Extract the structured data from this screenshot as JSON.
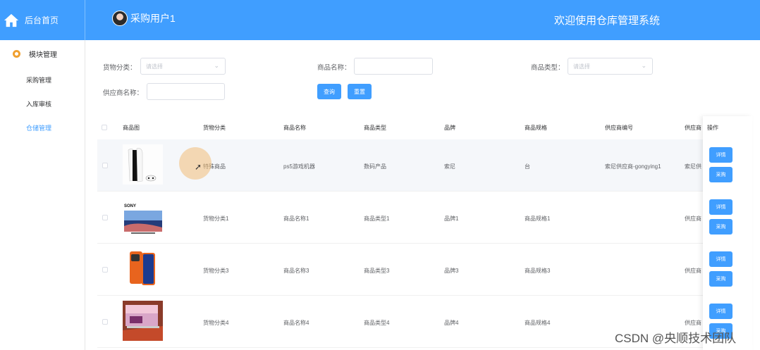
{
  "header": {
    "home_label": "后台首页",
    "user_name": "采购用户1",
    "welcome": "欢迎使用仓库管理系统"
  },
  "sidebar": {
    "group_label": "模块管理",
    "items": [
      {
        "label": "采购管理",
        "active": false
      },
      {
        "label": "入库审核",
        "active": false
      },
      {
        "label": "仓储管理",
        "active": true
      }
    ]
  },
  "search": {
    "category_label": "货物分类：",
    "category_placeholder": "请选择",
    "name_label": "商品名称：",
    "name_value": "",
    "type_label": "商品类型：",
    "type_placeholder": "请选择",
    "supplier_label": "供应商名称：",
    "supplier_value": "",
    "query_label": "查询",
    "reset_label": "重置"
  },
  "table": {
    "columns": [
      "商品图",
      "货物分类",
      "商品名称",
      "商品类型",
      "品牌",
      "商品规格",
      "供应商编号",
      "供应商",
      "操作"
    ],
    "rows": [
      {
        "category": "特殊商品",
        "name": "ps5游戏机器",
        "type": "数码产品",
        "brand": "索尼",
        "spec": "台",
        "supplier_no": "索尼供应商-gongying1",
        "supplier": "索尼供",
        "image": "ps5-console"
      },
      {
        "category": "货物分类1",
        "name": "商品名称1",
        "type": "商品类型1",
        "brand": "品牌1",
        "spec": "商品规格1",
        "supplier_no": "",
        "supplier": "供应商",
        "image": "sony-tv"
      },
      {
        "category": "货物分类3",
        "name": "商品名称3",
        "type": "商品类型3",
        "brand": "品牌3",
        "spec": "商品规格3",
        "supplier_no": "",
        "supplier": "供应商",
        "image": "orange-phone"
      },
      {
        "category": "货物分类4",
        "name": "商品名称4",
        "type": "商品类型4",
        "brand": "品牌4",
        "spec": "商品规格4",
        "supplier_no": "",
        "supplier": "供应商",
        "image": "laptop"
      }
    ],
    "detail_label": "详情",
    "purchase_label": "采购"
  },
  "brand_text": "SONY",
  "watermark": "CSDN @央顺技术团队",
  "colors": {
    "primary": "#409eff"
  }
}
